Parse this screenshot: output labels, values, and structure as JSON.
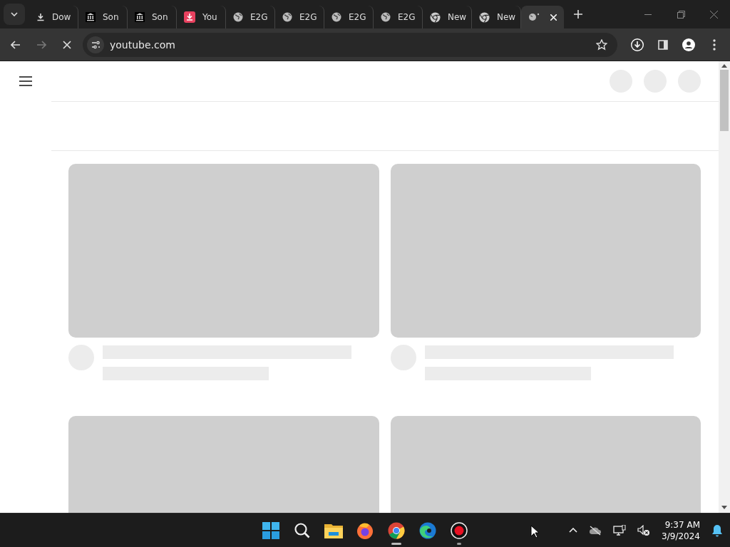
{
  "tabs": [
    {
      "kind": "download",
      "title": "Dow",
      "selected": false
    },
    {
      "kind": "bank",
      "title": "Son",
      "selected": false
    },
    {
      "kind": "bank",
      "title": "Son",
      "selected": false
    },
    {
      "kind": "red-download",
      "title": "You",
      "selected": false
    },
    {
      "kind": "globe",
      "title": "E2G",
      "selected": false
    },
    {
      "kind": "globe",
      "title": "E2G",
      "selected": false
    },
    {
      "kind": "globe",
      "title": "E2G",
      "selected": false
    },
    {
      "kind": "globe",
      "title": "E2G",
      "selected": false
    },
    {
      "kind": "chrome",
      "title": "New",
      "selected": false
    },
    {
      "kind": "chrome",
      "title": "New",
      "selected": false
    },
    {
      "kind": "loading",
      "selected": true
    }
  ],
  "toolbar": {
    "address": "youtube.com",
    "loading": true
  },
  "feed": [
    {
      "kind": "video-placeholder"
    },
    {
      "kind": "video-placeholder"
    },
    {
      "kind": "thumbnail-placeholder"
    },
    {
      "kind": "thumbnail-placeholder"
    }
  ],
  "taskbar": {
    "apps": [
      {
        "kind": "start",
        "running": false,
        "selected": false
      },
      {
        "kind": "search",
        "running": false,
        "selected": false
      },
      {
        "kind": "folder",
        "running": false,
        "selected": false
      },
      {
        "kind": "firefox",
        "running": false,
        "selected": false
      },
      {
        "kind": "chrome",
        "running": true,
        "selected": true
      },
      {
        "kind": "edge",
        "running": false,
        "selected": false
      },
      {
        "kind": "record",
        "running": true,
        "selected": false
      }
    ],
    "time": "9:37 AM",
    "date": "3/9/2024"
  }
}
